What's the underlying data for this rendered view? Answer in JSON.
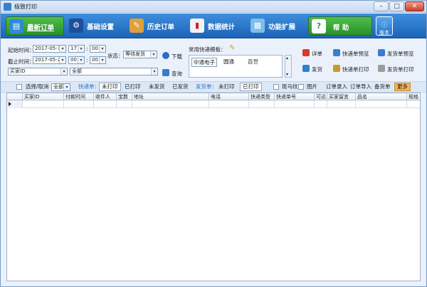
{
  "window": {
    "title": "极致打印",
    "icon": "printer-app-icon"
  },
  "nav": [
    {
      "label": "最新订单",
      "icon": "new-orders-icon"
    },
    {
      "label": "基础设置",
      "icon": "settings-gear-icon"
    },
    {
      "label": "历史订单",
      "icon": "history-icon"
    },
    {
      "label": "数据统计",
      "icon": "chart-icon"
    },
    {
      "label": "功能扩展",
      "icon": "extension-icon"
    },
    {
      "label": "帮  助",
      "icon": "help-icon"
    },
    {
      "label": "版本",
      "icon": "about-icon"
    }
  ],
  "filter": {
    "start_label": "起始时间：",
    "start_date": "2017-05-19",
    "start_hour": "17",
    "start_min": "00",
    "end_label": "截止时间：",
    "end_date": "2017-05-26",
    "end_hour": "00",
    "end_min": "00",
    "colon": ":",
    "status_label": "状态：",
    "status_value": "等待发货",
    "download_label": "下载",
    "buyer_id_label": "买家ID",
    "all_option": "全部",
    "query_label": "查询",
    "courier_template_label": "常用快递模板：",
    "couriers": [
      "中通电子",
      "圆通",
      "百世"
    ]
  },
  "actions": [
    {
      "label": "详单",
      "icon": "detail-icon",
      "color": "#d43b2b"
    },
    {
      "label": "快递单预览",
      "icon": "preview-icon",
      "color": "#3b7bd4"
    },
    {
      "label": "发货单预览",
      "icon": "preview-doc-icon",
      "color": "#3b7bd4"
    },
    {
      "label": "发货",
      "icon": "ship-icon",
      "color": "#2e7fd0"
    },
    {
      "label": "快递单打印",
      "icon": "print-icon",
      "color": "#c79a2a"
    },
    {
      "label": "发货单打印",
      "icon": "print-doc-icon",
      "color": "#9b9b9b"
    }
  ],
  "toolbar": {
    "select_label": "选择/取消",
    "select_value": "全部",
    "express_label": "快递单：",
    "not_printed": "未打印",
    "printed": "已打印",
    "unshipped": "未发货",
    "shipped": "已发货",
    "ship_label": "发货单：",
    "ship_not_printed": "未打印",
    "ship_printed": "已打印",
    "zebra_label": "斑马纹",
    "image_label": "图片",
    "order_entry": "订单录入",
    "order_import": "订单导入",
    "spare": "备货单",
    "more": "更多"
  },
  "grid": {
    "headers": [
      "买家ID",
      "付款时间",
      "收件人",
      "宝数",
      "地址",
      "电话",
      "快递类型",
      "快递单号",
      "可达",
      "买家留言",
      "品名",
      "规格"
    ]
  }
}
